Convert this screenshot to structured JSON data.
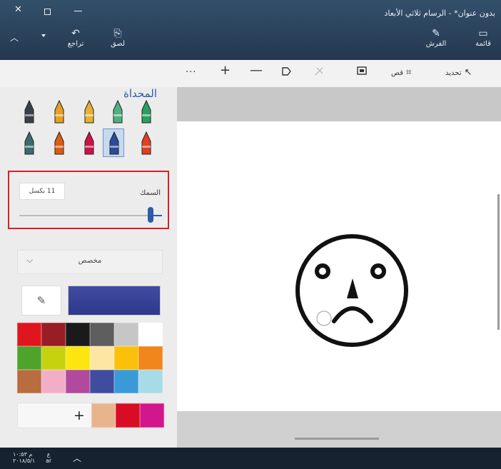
{
  "window": {
    "title": "بدون عنوان* - الرسام ثلاثي الأبعاد",
    "close_glyph": "✕",
    "up_glyph": "︿"
  },
  "ribbon": {
    "undo_label": "تراجع",
    "undo_glyph": "↶",
    "paste_label": "لصق",
    "paste_glyph": "⎘",
    "brushes_label": "الفرش",
    "brushes_glyph": "✎",
    "menu_label": "قائمة",
    "menu_glyph": "▭"
  },
  "toolbar": {
    "more": "···",
    "zoom_in": "+",
    "zoom_out": "—",
    "crop_label": "قص",
    "select_label": "تحديد"
  },
  "panel": {
    "title": "المحداة",
    "brushes": [
      {
        "name": "marker-brush",
        "color": "#3a3f48"
      },
      {
        "name": "calligraphy-pen-brush",
        "color": "#e8a020"
      },
      {
        "name": "oil-brush",
        "color": "#e8b030"
      },
      {
        "name": "watercolor-brush",
        "color": "#50b080"
      },
      {
        "name": "pixel-pen-brush",
        "color": "#2aa060"
      },
      {
        "name": "spray-can-brush",
        "color": "#3a6a70"
      },
      {
        "name": "pencil-brush",
        "color": "#e05a10"
      },
      {
        "name": "crayon-brush",
        "color": "#d01048"
      },
      {
        "name": "eraser-brush",
        "color": "#2a4a9a"
      },
      {
        "name": "fill-brush",
        "color": "#e04020"
      }
    ],
    "thickness": {
      "label": "السمك",
      "value": "11 بكسل",
      "level": 0.92
    },
    "color_mode": {
      "label": "مخصص",
      "chevron": "⌵"
    },
    "eyedropper_glyph": "✎",
    "current_color": "#2d3a8c",
    "palette": [
      "#e0161e",
      "#981d24",
      "#1a1a1a",
      "#5e5e5e",
      "#c6c6c6",
      "#ffffff",
      "#4ea42a",
      "#c6d20f",
      "#fbe60f",
      "#fde6a4",
      "#fbc10a",
      "#f0861c",
      "#b96c3f",
      "#f2aec6",
      "#b04a9d",
      "#404c9f",
      "#3a9ad8",
      "#a7dbe6"
    ],
    "custom_colors": [
      "#e8b48e",
      "#d80d24",
      "#d2168c"
    ],
    "add_glyph": "+"
  },
  "taskbar": {
    "time": "م ١٠:٥٣",
    "date": "٢٠١٨/٥/١",
    "lang": "ع",
    "lang2": "ar",
    "up_glyph": "︿"
  }
}
